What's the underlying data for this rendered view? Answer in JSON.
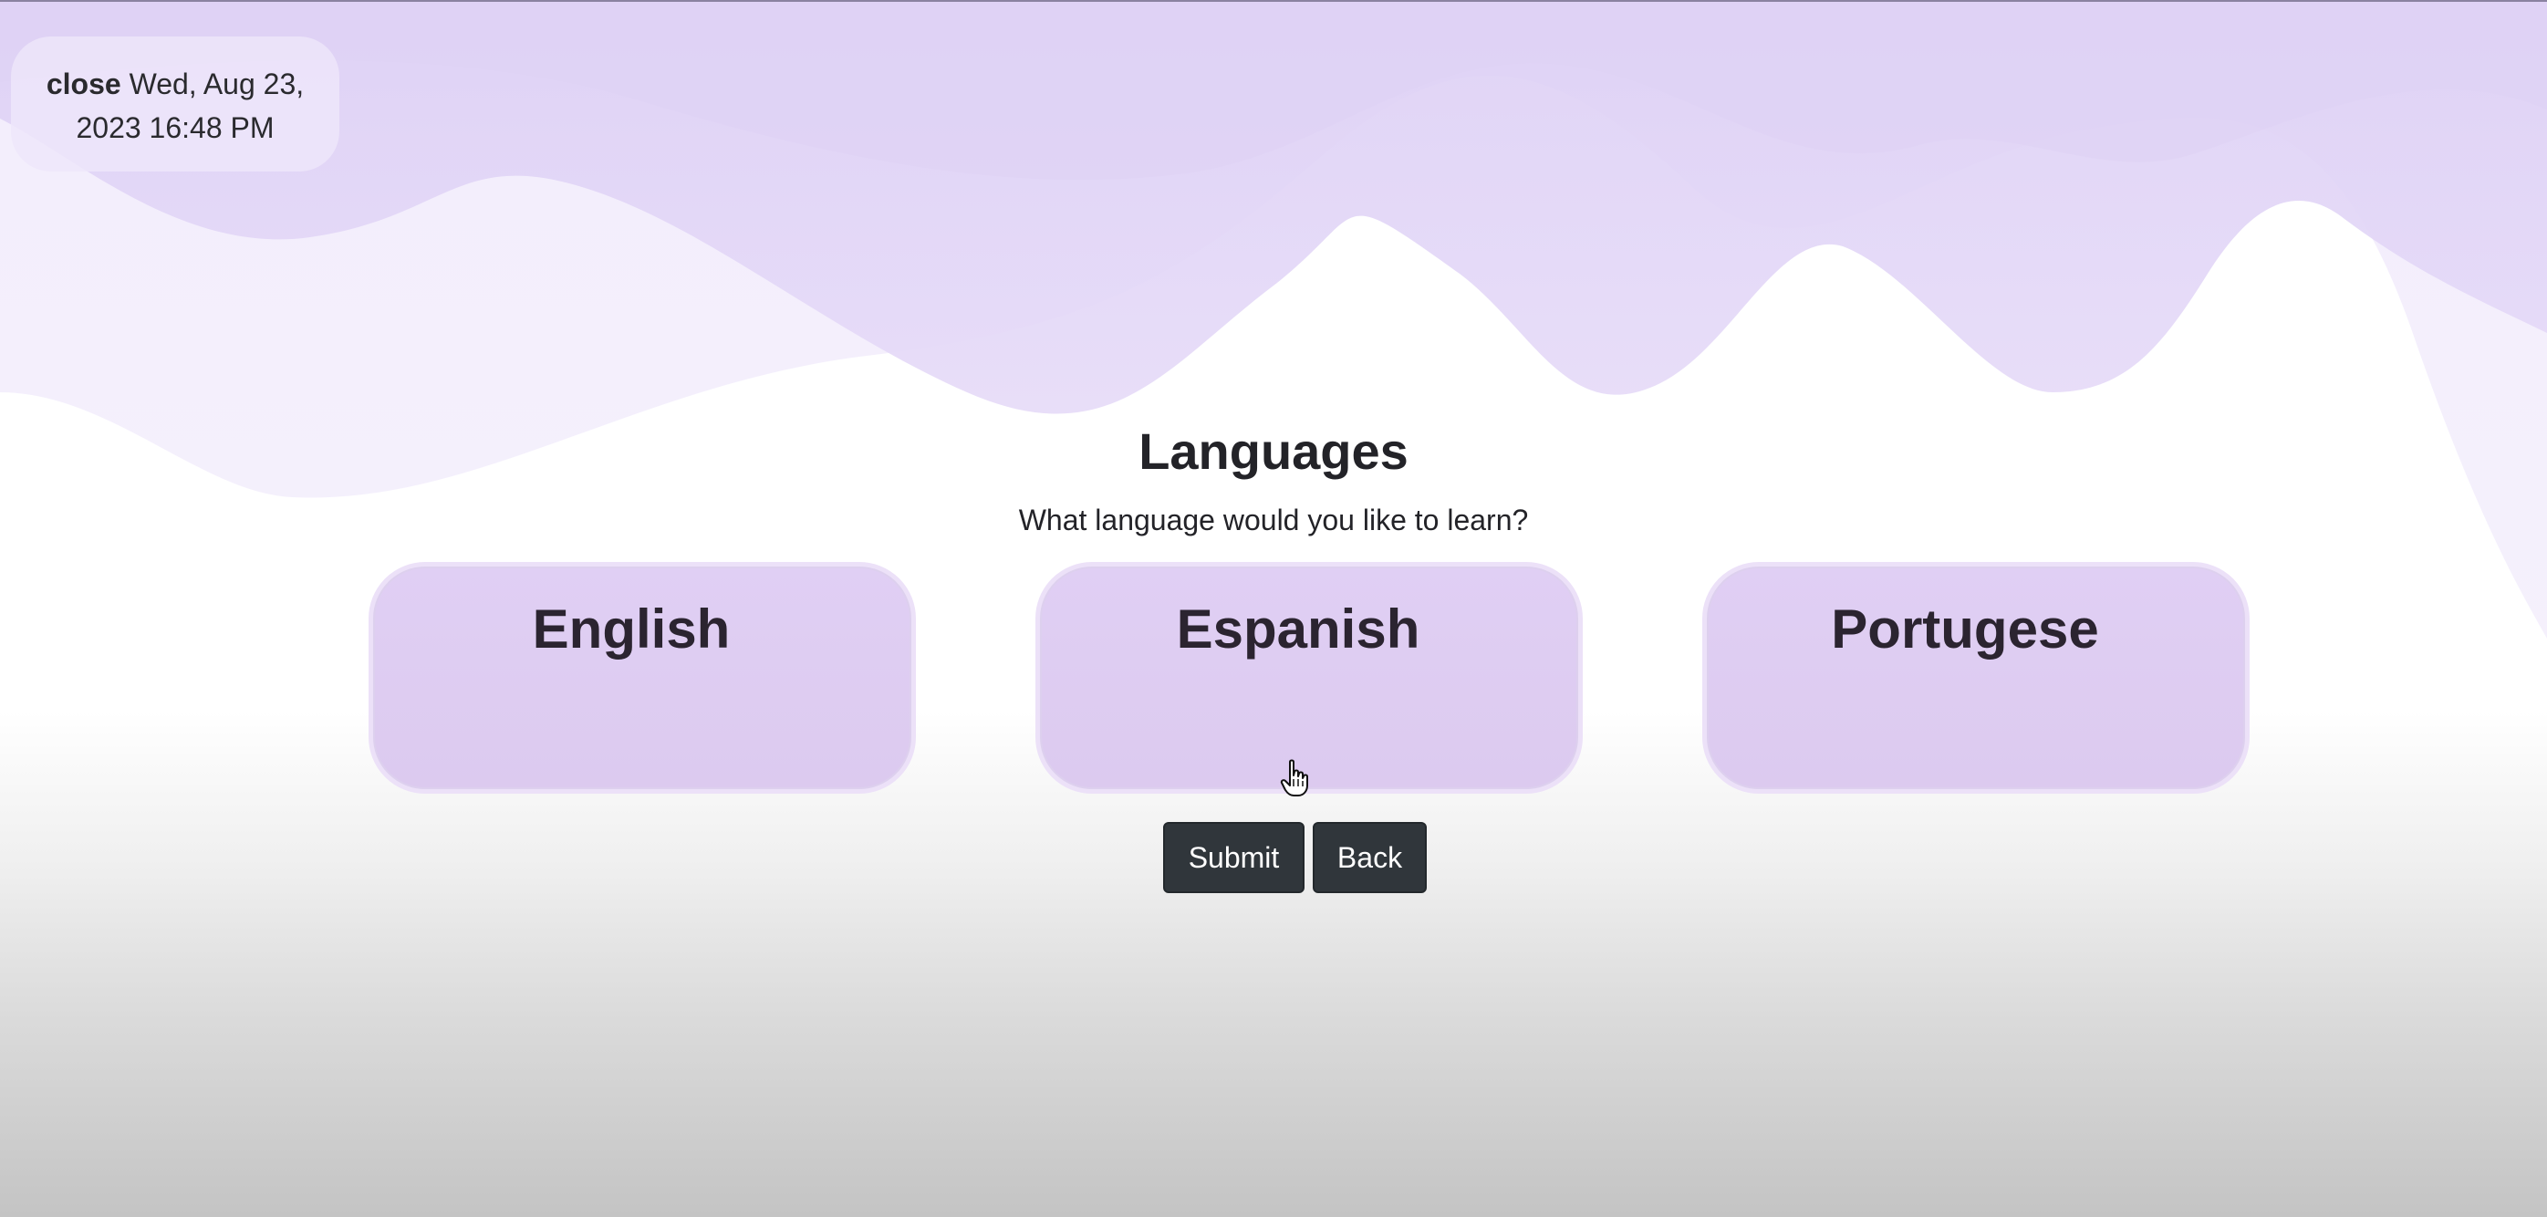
{
  "status": {
    "close_label": "close",
    "datetime_line1": "Wed, Aug 23,",
    "datetime_line2": "2023 16:48 PM"
  },
  "page": {
    "title": "Languages",
    "question": "What language would you like to learn?"
  },
  "languages": [
    {
      "label": "English"
    },
    {
      "label": "Espanish"
    },
    {
      "label": "Portugese"
    }
  ],
  "buttons": {
    "submit_label": "Submit",
    "back_label": "Back"
  },
  "colors": {
    "card_fill": "#e0cff4",
    "wave_primary": "#e1d5f6",
    "wave_secondary": "#ece4fa",
    "button_bg": "#30363b"
  },
  "icons": {
    "cursor": "hand-pointer-icon"
  }
}
